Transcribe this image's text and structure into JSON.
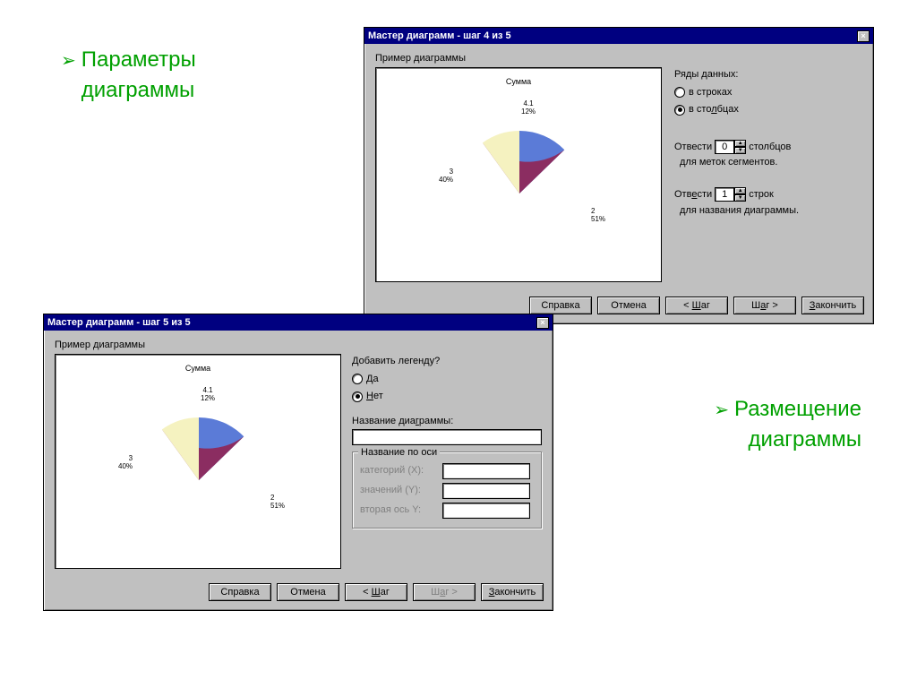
{
  "annotations": {
    "top_left": "Параметры\nдиаграммы",
    "bottom_right": "Размещение\nдиаграммы"
  },
  "chart_data": {
    "type": "pie",
    "title": "Сумма",
    "series": [
      {
        "name": "4.1",
        "percent": 12,
        "color": "#5b7bd7"
      },
      {
        "name": "2",
        "percent": 51,
        "color": "#8b2d61"
      },
      {
        "name": "3",
        "percent": 40,
        "color": "#f5f2c0"
      }
    ],
    "labels": {
      "seg1": "4.1\n12%",
      "seg2": "2\n51%",
      "seg3": "3\n40%"
    }
  },
  "dialog1": {
    "title": "Мастер диаграмм - шаг 4 из 5",
    "preview_label": "Пример диаграммы",
    "series_label": "Ряды данных:",
    "radio_rows": "в строках",
    "radio_cols": "в столбцах",
    "allocate1_a": "Отвести",
    "allocate1_b": "столбцов",
    "allocate1_c": "для меток сегментов.",
    "allocate1_val": "0",
    "allocate2_a": "Отвести",
    "allocate2_b": "строк",
    "allocate2_c": "для названия диаграммы.",
    "allocate2_val": "1",
    "buttons": {
      "help": "Справка",
      "cancel": "Отмена",
      "prev": "< Шаг",
      "next": "Шаг >",
      "finish": "Закончить"
    }
  },
  "dialog2": {
    "title": "Мастер диаграмм - шаг 5 из 5",
    "preview_label": "Пример диаграммы",
    "legend_label": "Добавить легенду?",
    "radio_yes": "Да",
    "radio_no": "Нет",
    "chart_title_label": "Название диаграммы:",
    "chart_title_value": "",
    "axis_group": "Название по оси",
    "axis_x": "категорий (X):",
    "axis_y": "значений (Y):",
    "axis_y2": "вторая ось Y:",
    "buttons": {
      "help": "Справка",
      "cancel": "Отмена",
      "prev": "< Шаг",
      "next": "Шаг >",
      "finish": "Закончить"
    }
  }
}
